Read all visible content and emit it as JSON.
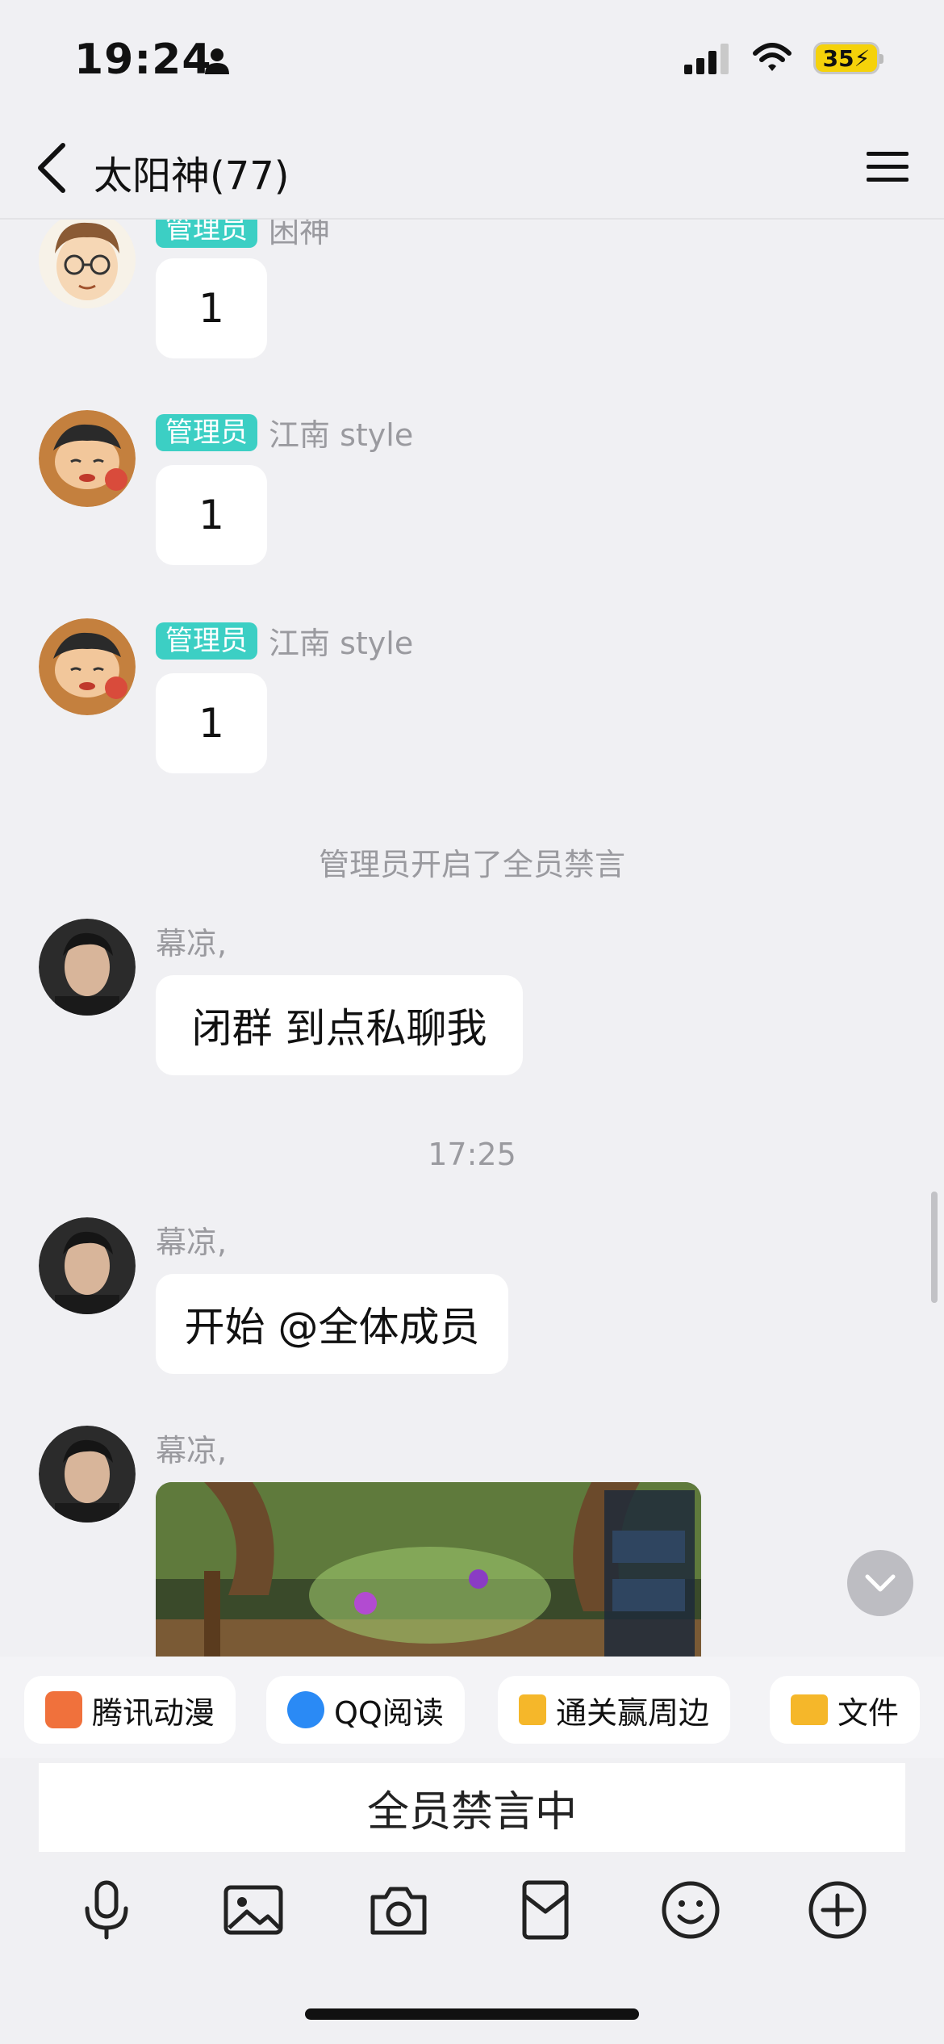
{
  "status_bar": {
    "time": "19:24",
    "battery": "35"
  },
  "header": {
    "title": "太阳神(77)"
  },
  "messages": [
    {
      "badge": "管理员",
      "nickname": "困神",
      "text": "1"
    },
    {
      "badge": "管理员",
      "nickname": "江南 style",
      "text": "1"
    },
    {
      "badge": "管理员",
      "nickname": "江南 style",
      "text": "1"
    }
  ],
  "system_notice": "管理员开启了全员禁言",
  "message_4": {
    "nickname": "幕凉,",
    "text": "闭群  到点私聊我"
  },
  "timestamp": "17:25",
  "message_5": {
    "nickname": "幕凉,",
    "text": "开始 @全体成员"
  },
  "message_6": {
    "nickname": "幕凉,"
  },
  "quick_apps": [
    {
      "label": "腾讯动漫",
      "icon": "comic-icon",
      "color": "#f0713c"
    },
    {
      "label": "QQ阅读",
      "icon": "qq-read-icon",
      "color": "#2a8af5"
    },
    {
      "label": "通关赢周边",
      "icon": "gift-icon",
      "color": "#f5b72a"
    },
    {
      "label": "文件",
      "icon": "folder-icon",
      "color": "#f5b72a"
    }
  ],
  "mute_bar": {
    "text": "全员禁言中"
  },
  "toolbar": [
    "microphone-icon",
    "image-icon",
    "camera-icon",
    "red-packet-icon",
    "emoji-icon",
    "plus-icon"
  ]
}
